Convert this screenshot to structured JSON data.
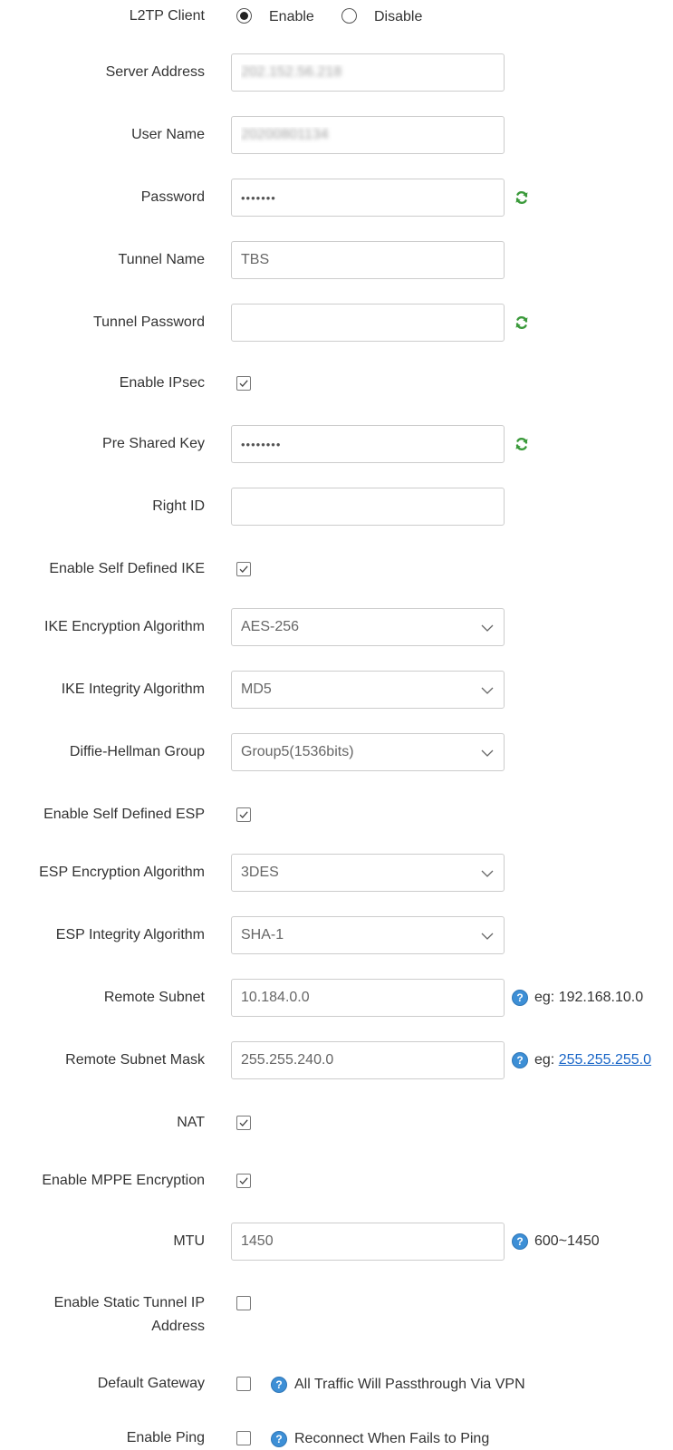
{
  "l2tp_client": {
    "label": "L2TP Client",
    "enable_label": "Enable",
    "disable_label": "Disable"
  },
  "server_address": {
    "label": "Server Address",
    "value": "202.152.56.218"
  },
  "user_name": {
    "label": "User Name",
    "value": "20200801134"
  },
  "password": {
    "label": "Password",
    "value": "•••••••"
  },
  "tunnel_name": {
    "label": "Tunnel Name",
    "value": "TBS"
  },
  "tunnel_password": {
    "label": "Tunnel Password",
    "value": ""
  },
  "enable_ipsec": {
    "label": "Enable IPsec",
    "checked": true
  },
  "pre_shared_key": {
    "label": "Pre Shared Key",
    "value": "••••••••"
  },
  "right_id": {
    "label": "Right ID",
    "value": ""
  },
  "enable_self_defined_ike": {
    "label": "Enable Self Defined IKE",
    "checked": true
  },
  "ike_encryption": {
    "label": "IKE Encryption Algorithm",
    "value": "AES-256"
  },
  "ike_integrity": {
    "label": "IKE Integrity Algorithm",
    "value": "MD5"
  },
  "dh_group": {
    "label": "Diffie-Hellman Group",
    "value": "Group5(1536bits)"
  },
  "enable_self_defined_esp": {
    "label": "Enable Self Defined ESP",
    "checked": true
  },
  "esp_encryption": {
    "label": "ESP Encryption Algorithm",
    "value": "3DES"
  },
  "esp_integrity": {
    "label": "ESP Integrity Algorithm",
    "value": "SHA-1"
  },
  "remote_subnet": {
    "label": "Remote Subnet",
    "value": "10.184.0.0",
    "hint": "eg: 192.168.10.0"
  },
  "remote_subnet_mask": {
    "label": "Remote Subnet Mask",
    "value": "255.255.240.0",
    "hint_prefix": "eg: ",
    "hint_link": "255.255.255.0"
  },
  "nat": {
    "label": "NAT",
    "checked": true
  },
  "enable_mppe": {
    "label": "Enable MPPE Encryption",
    "checked": true
  },
  "mtu": {
    "label": "MTU",
    "value": "1450",
    "hint": "600~1450"
  },
  "enable_static_tunnel_ip": {
    "label": "Enable Static Tunnel IP Address",
    "checked": false
  },
  "default_gateway": {
    "label": "Default Gateway",
    "checked": false,
    "hint": "All Traffic Will Passthrough Via VPN"
  },
  "enable_ping": {
    "label": "Enable Ping",
    "checked": false,
    "hint": "Reconnect When Fails to Ping"
  },
  "colors": {
    "label_text": "#333333",
    "field_border": "#cccccc",
    "help_icon": "#3d8fd6",
    "refresh_icon": "#3b9a3b",
    "link": "#1a66c7"
  },
  "icons": {
    "refresh": "refresh-icon",
    "help": "help-icon",
    "dropdown": "chevron-down-icon",
    "check": "check-icon"
  }
}
